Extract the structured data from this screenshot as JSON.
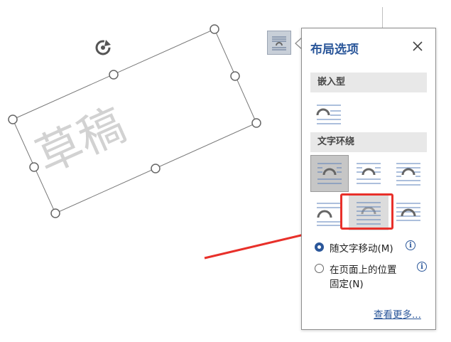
{
  "document": {
    "watermark_text": "草稿"
  },
  "layout_options": {
    "title": "布局选项",
    "close_label": "×",
    "inline_section": "嵌入型",
    "wrap_section": "文字环绕",
    "move_with_text_label": "随文字移动(M)",
    "fix_position_label_line1": "在页面上的位置",
    "fix_position_label_line2": "固定(N)",
    "info_glyph": "i",
    "see_more_label": "查看更多...",
    "accent_color": "#2b579a",
    "highlight_color": "#e8302a"
  }
}
